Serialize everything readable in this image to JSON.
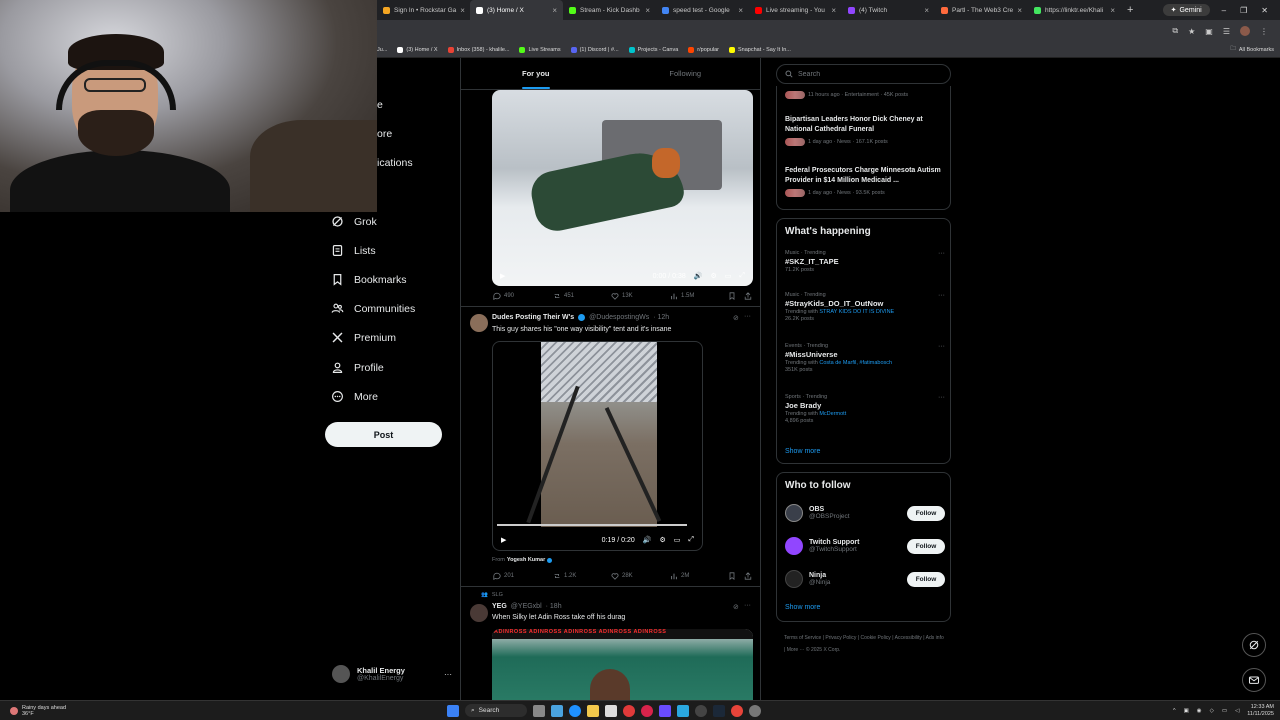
{
  "browser": {
    "tabs": [
      {
        "label": "Sign In • Rockstar Ga",
        "color": "#f5a623",
        "active": false
      },
      {
        "label": "(3) Home / X",
        "color": "#ffffff",
        "active": true
      },
      {
        "label": "Stream - Kick Dashb",
        "color": "#53fc18",
        "active": false
      },
      {
        "label": "speed test - Google",
        "color": "#4285f4",
        "active": false
      },
      {
        "label": "Live streaming - You",
        "color": "#ff0000",
        "active": false
      },
      {
        "label": "(4) Twitch",
        "color": "#9146ff",
        "active": false
      },
      {
        "label": "Partl - The Web3 Cre",
        "color": "#ff6a3d",
        "active": false
      },
      {
        "label": "https://linktr.ee/Khali",
        "color": "#43e660",
        "active": false
      }
    ],
    "tab_close": "×",
    "new_tab": "+",
    "gemini_label": "Gemini",
    "window_controls": [
      "–",
      "❐",
      "✕"
    ],
    "bookmarks": [
      {
        "label": "(3) Home / X",
        "color": "#ffffff"
      },
      {
        "label": "Inbox (358) - khalile...",
        "color": "#ea4335"
      },
      {
        "label": "Live Streams",
        "color": "#53fc18"
      },
      {
        "label": "(1) Discord | #...",
        "color": "#5865f2"
      },
      {
        "label": "Projects - Canva",
        "color": "#00c4cc"
      },
      {
        "label": "r/popular",
        "color": "#ff4500"
      },
      {
        "label": "Snapchat - Say It In...",
        "color": "#fffc00"
      }
    ],
    "bookmarks_all": "All Bookmarks",
    "bookmark_stub": "Ju..."
  },
  "nav": {
    "partial": [
      "e",
      "ore",
      "ications"
    ],
    "items": [
      {
        "label": "Grok",
        "icon": "grok-icon"
      },
      {
        "label": "Lists",
        "icon": "lists-icon"
      },
      {
        "label": "Bookmarks",
        "icon": "bookmark-icon"
      },
      {
        "label": "Communities",
        "icon": "communities-icon"
      },
      {
        "label": "Premium",
        "icon": "x-logo-icon"
      },
      {
        "label": "Profile",
        "icon": "profile-icon"
      },
      {
        "label": "More",
        "icon": "more-icon"
      }
    ],
    "post_label": "Post",
    "profile_name": "Khalil Energy",
    "profile_handle": "@KhalilEnergy",
    "profile_dots": "···"
  },
  "feed": {
    "tabs": [
      "For you",
      "Following"
    ],
    "tweet1": {
      "video_time": "0:00 / 0:38",
      "replies": "490",
      "reposts": "451",
      "likes": "13K",
      "views": "1.5M"
    },
    "tweet2": {
      "name": "Dudes Posting Their W's",
      "handle": "@DudespostingWs",
      "time": "· 12h",
      "text": "This guy shares his \"one way visibility\" tent and it's insane",
      "video_time": "0:19 / 0:20",
      "from_label": "From",
      "from_name": "Yogesh Kumar",
      "replies": "201",
      "reposts": "1.2K",
      "likes": "28K",
      "views": "2M"
    },
    "tweet3": {
      "social_context": "SLG",
      "name": "YEG",
      "handle": "@YEGxbl",
      "time": "· 18h",
      "text": "When Silky let Adin Ross take off his durag",
      "banner": "ADINROSS"
    }
  },
  "sidebar": {
    "search_placeholder": "Search",
    "news": [
      {
        "title": "",
        "meta": "11 hours ago · Entertainment · 45K posts"
      },
      {
        "title": "Bipartisan Leaders Honor Dick Cheney at National Cathedral Funeral",
        "meta": "1 day ago · News · 167.1K posts"
      },
      {
        "title": "Federal Prosecutors Charge Minnesota Autism Provider in $14 Million Medicaid ...",
        "meta": "1 day ago · News · 93.5K posts"
      }
    ],
    "whats_happening_title": "What's happening",
    "trends": [
      {
        "category": "Music · Trending",
        "name": "#SKZ_IT_TAPE",
        "with_label": "",
        "with": "",
        "count": "71.2K posts"
      },
      {
        "category": "Music · Trending",
        "name": "#StrayKids_DO_IT_OutNow",
        "with_label": "Trending with",
        "with": "STRAY KIDS DO IT IS DIVINE",
        "count": "26.2K posts"
      },
      {
        "category": "Events · Trending",
        "name": "#MissUniverse",
        "with_label": "Trending with",
        "with": "Costa de Marfil, #fatimabosch",
        "count": "351K posts"
      },
      {
        "category": "Sports · Trending",
        "name": "Joe Brady",
        "with_label": "Trending with",
        "with": "McDermott",
        "count": "4,896 posts"
      }
    ],
    "trend_dots": "···",
    "show_more": "Show more",
    "who_to_follow_title": "Who to follow",
    "follow_suggestions": [
      {
        "name": "OBS",
        "handle": "@OBSProject",
        "color": "#3a3f4a"
      },
      {
        "name": "Twitch Support",
        "handle": "@TwitchSupport",
        "color": "#9146ff"
      },
      {
        "name": "Ninja",
        "handle": "@Ninja",
        "color": "#222222"
      }
    ],
    "follow_label": "Follow",
    "footer": [
      "Terms of Service",
      "Privacy Policy",
      "Cookie Policy",
      "Accessibility",
      "Ads info",
      "More ···",
      "© 2025 X Corp."
    ]
  },
  "taskbar": {
    "weather_line1": "Rainy days ahead",
    "weather_line2": "36°F",
    "search_label": "Search",
    "time": "12:33 AM",
    "date": "11/11/2025"
  },
  "colors": {
    "accent": "#1d9bf0",
    "background": "#000000",
    "border": "#2f3336",
    "muted": "#71767b"
  }
}
